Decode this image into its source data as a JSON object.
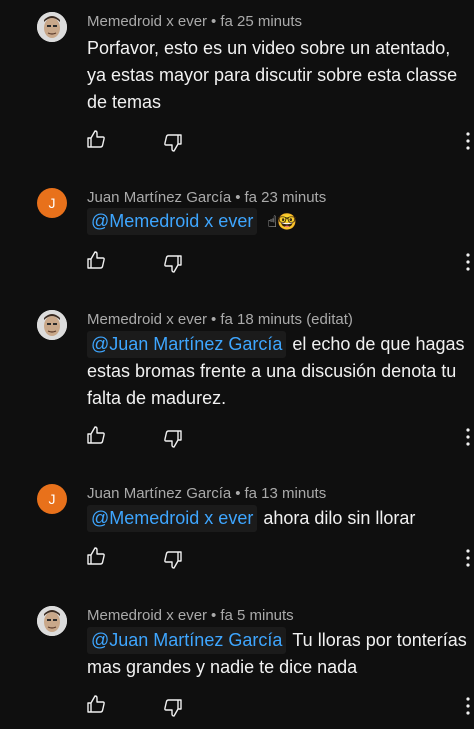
{
  "comments": [
    {
      "author": "Memedroid x ever",
      "time": "fa 25 minuts",
      "avatar_type": "photo",
      "mention": "",
      "text": "Porfavor, esto es un video sobre un atentado, ya estas mayor para discutir sobre esta classe de temas"
    },
    {
      "author": "Juan Martínez García",
      "time": "fa 23 minuts",
      "avatar_type": "letter",
      "avatar_letter": "J",
      "mention": "@Memedroid x ever",
      "text": "",
      "emojis": "☝🤓"
    },
    {
      "author": "Memedroid x ever",
      "time": "fa 18 minuts (editat)",
      "avatar_type": "photo",
      "mention": "@Juan Martínez García",
      "text": "el echo de que hagas estas bromas frente a una discusión denota tu falta de madurez."
    },
    {
      "author": "Juan Martínez García",
      "time": "fa 13 minuts",
      "avatar_type": "letter",
      "avatar_letter": "J",
      "mention": "@Memedroid x ever",
      "text": "ahora dilo sin llorar"
    },
    {
      "author": "Memedroid x ever",
      "time": "fa 5 minuts",
      "avatar_type": "photo",
      "mention": "@Juan Martínez García",
      "text": "Tu lloras por tonterías mas grandes y nadie te dice nada"
    }
  ],
  "separator": "•",
  "icons": {
    "like": "thumbs-up-icon",
    "dislike": "thumbs-down-icon",
    "more": "more-vertical-icon"
  },
  "colors": {
    "background": "#0f0f0f",
    "text": "#f1f1f1",
    "meta": "#aaaaaa",
    "mention": "#3ea6ff",
    "avatar_letter_bg": "#e8711b"
  }
}
